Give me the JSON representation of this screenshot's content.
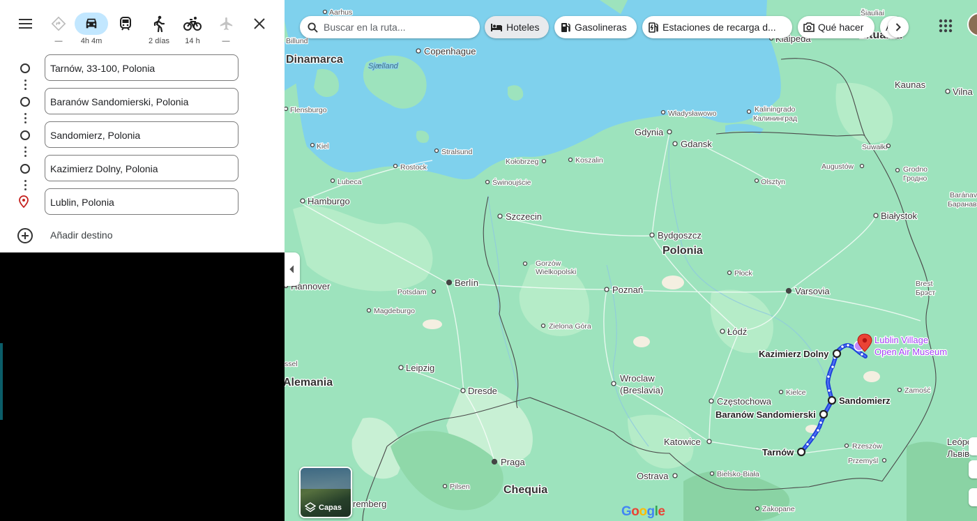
{
  "panel": {
    "modes": [
      {
        "name": "best",
        "label": "—"
      },
      {
        "name": "car",
        "label": "4h 4m"
      },
      {
        "name": "transit",
        "label": ""
      },
      {
        "name": "walk",
        "label": "2 días"
      },
      {
        "name": "bike",
        "label": "14 h"
      },
      {
        "name": "flight",
        "label": "—"
      }
    ],
    "stops": [
      "Tarnów, 33-100, Polonia",
      "Baranów Sandomierski, Polonia",
      "Sandomierz, Polonia",
      "Kazimierz Dolny, Polonia",
      "Lublin, Polonia"
    ],
    "add_destination": "Añadir destino"
  },
  "map": {
    "search_placeholder": "Buscar en la ruta...",
    "chips": [
      "Hoteles",
      "Gasolineras",
      "Estaciones de recarga d...",
      "Qué hacer",
      "A"
    ],
    "layers_label": "Capas",
    "labels": {
      "aarhus": "Aarhus",
      "billund": "Billund",
      "copenhague": "Copenhague",
      "dinamarca": "Dinamarca",
      "sjaelland": "Sjælland",
      "flensburgo": "Flensburgo",
      "kiel": "Kiel",
      "stralsund": "Stralsund",
      "rostock": "Rostock",
      "lubeca": "Lubeca",
      "hamburgo": "Hamburgo",
      "kolobrzeg": "Kołobrzeg",
      "koszalin": "Koszalin",
      "swinoujscie": "Świnoujście",
      "wladyslawowo": "Władysławowo",
      "gdynia": "Gdynia",
      "gdansk": "Gdansk",
      "kaliningrado": "Kaliningrado",
      "kaliningrado_ru": "Калининград",
      "siauliai": "Šiauliai",
      "klaipeda": "Klaipeda",
      "lituania": "Lituania",
      "kaunas": "Kaunas",
      "vilna": "Vilna",
      "suwalki": "Suwałki",
      "augustow": "Augustów",
      "grodno": "Grodno",
      "grodno_by": "Гродно",
      "baranav": "Baránav",
      "baranav_by": "Баранав",
      "olsztyn": "Olsztyn",
      "bialystok": "Białystok",
      "szczecin": "Szczecin",
      "bydgoszcz": "Bydgoszcz",
      "polonia": "Polonia",
      "plock": "Płock",
      "gorzow": "Gorzów",
      "gorzow2": "Wielkopolski",
      "berlin": "Berlín",
      "potsdam": "Potsdam",
      "poznan": "Poznań",
      "varsovia": "Varsovia",
      "brest": "Brest",
      "brest_by": "Брэст",
      "hannover": "Hannover",
      "magdeburgo": "Magdeburgo",
      "zielona": "Zielona Góra",
      "lodz": "Łódź",
      "lublin_village": "Lublin Village",
      "lublin_village2": "Open Air Museum",
      "kazimierz": "Kazimierz Dolny",
      "kassel": "ssel",
      "leipzig": "Leipzig",
      "alemania": "Alemania",
      "wroclaw": "Wroclaw",
      "breslavia": "(Breslavia)",
      "kielce": "Kielce",
      "zamosc": "Zamość",
      "dresde": "Dresde",
      "czestochowa": "Częstochowa",
      "sandomierz": "Sandomierz",
      "baranow": "Baranów Sandomierski",
      "katowice": "Katowice",
      "rzeszow": "Rzeszów",
      "przemysl": "Przemyśl",
      "leopol": "Leópol",
      "lviv": "Львів",
      "praga": "Praga",
      "tarnow": "Tarnów",
      "ostrava": "Ostrava",
      "bielsko": "Bielsko-Biała",
      "pilsen": "Pilsen",
      "chequia": "Chequia",
      "nuremberg": "remberg",
      "zakopane": "Zakopane"
    }
  }
}
